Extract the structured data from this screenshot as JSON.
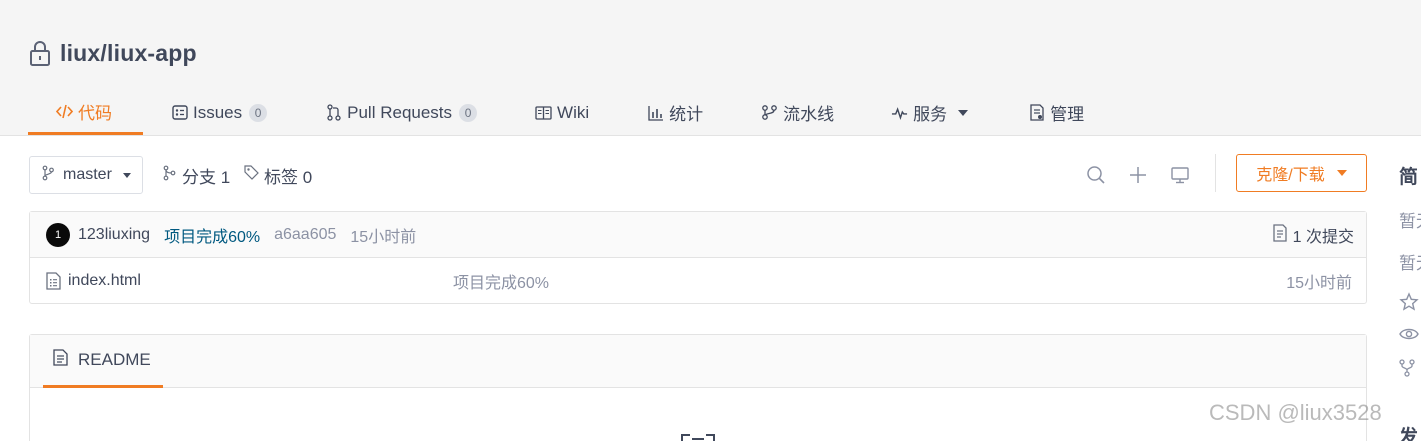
{
  "repo": {
    "path": "liux/liux-app"
  },
  "tabs": [
    {
      "label": "代码",
      "icon": "code-icon",
      "badge": ""
    },
    {
      "label": "Issues",
      "icon": "issues-icon",
      "badge": "0"
    },
    {
      "label": "Pull Requests",
      "icon": "pull-request-icon",
      "badge": "0"
    },
    {
      "label": "Wiki",
      "icon": "wiki-icon",
      "badge": ""
    },
    {
      "label": "统计",
      "icon": "stats-icon",
      "badge": ""
    },
    {
      "label": "流水线",
      "icon": "pipeline-icon",
      "badge": ""
    },
    {
      "label": "服务",
      "icon": "pulse-icon",
      "badge": ""
    },
    {
      "label": "管理",
      "icon": "settings-doc-icon",
      "badge": ""
    }
  ],
  "toolbar": {
    "branch": "master",
    "branches_label": "分支 1",
    "tags_label": "标签 0",
    "clone_label": "克隆/下载"
  },
  "commit": {
    "avatar_text": "1",
    "author": "123liuxing",
    "message": "项目完成60%",
    "hash": "a6aa605",
    "time": "15小时前",
    "count_label": "1 次提交"
  },
  "files": [
    {
      "name": "index.html",
      "commit_message": "项目完成60%",
      "time": "15小时前"
    }
  ],
  "readme": {
    "tab_label": "README"
  },
  "sidebar": {
    "title": "简",
    "line1": "暂无",
    "line2": "暂无",
    "bottom": "发"
  },
  "watermark": "CSDN @liux3528",
  "colors": {
    "accent": "#f07c23",
    "link": "#005980",
    "muted": "#8c92a4"
  }
}
